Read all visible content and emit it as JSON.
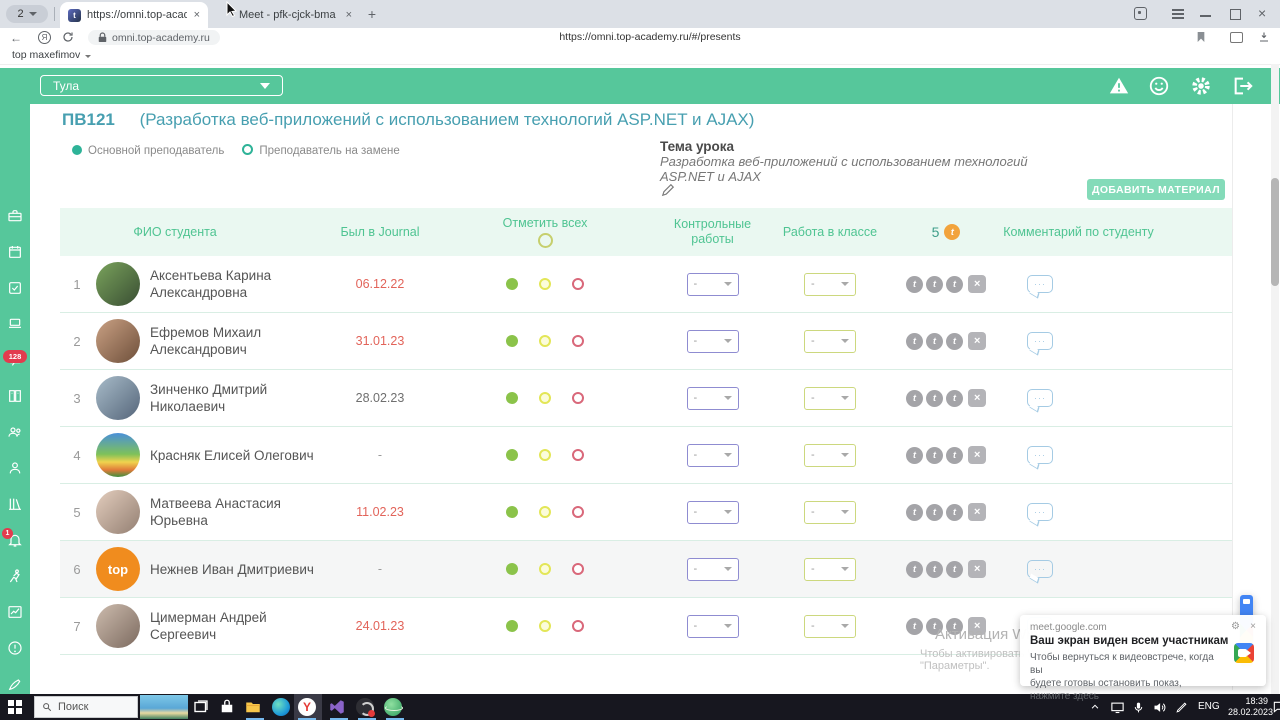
{
  "browser": {
    "tab_count": "2",
    "tab1_title": "https://omni.top-acaden",
    "tab2_title": "Meet - pfk-cjck-bma",
    "url_domain": "omni.top-academy.ru",
    "url_full": "https://omni.top-academy.ru/#/presents",
    "bookmark_label": "top maxefimov"
  },
  "appbar": {
    "city": "Тула"
  },
  "page": {
    "group_code": "ПВ121",
    "group_name": "(Разработка веб-приложений с использованием технологий ASP.NET и AJAX)",
    "legend_main": "Основной преподаватель",
    "legend_substitute": "Преподаватель на замене",
    "topic_label": "Тема урока",
    "topic_line1": "Разработка веб-приложений с использованием технологий",
    "topic_line2": "ASP.NET и AJAX",
    "add_material": "ДОБАВИТЬ МАТЕРИАЛ"
  },
  "table": {
    "col_name": "ФИО студента",
    "col_journal": "Был в Journal",
    "col_mark_all": "Отметить всех",
    "col_tests_1": "Контрольные",
    "col_tests_2": "работы",
    "col_classwork": "Работа в классе",
    "col_coins": "5",
    "col_comment": "Комментарий по студенту",
    "dropdown_value": "-",
    "rows": [
      {
        "num": "1",
        "name": "Аксентьева Карина Александровна",
        "journal": "06.12.22",
        "journal_class": "date red"
      },
      {
        "num": "2",
        "name": "Ефремов Михаил Александрович",
        "journal": "31.01.23",
        "journal_class": "date red"
      },
      {
        "num": "3",
        "name": "Зинченко Дмитрий Николаевич",
        "journal": "28.02.23",
        "journal_class": "date dark"
      },
      {
        "num": "4",
        "name": "Красняк Елисей Олегович",
        "journal": "-",
        "journal_class": "date"
      },
      {
        "num": "5",
        "name": "Матвеева Анастасия Юрьевна",
        "journal": "11.02.23",
        "journal_class": "date red"
      },
      {
        "num": "6",
        "name": "Нежнев Иван Дмитриевич",
        "journal": "-",
        "journal_class": "date",
        "avatar_text": "top"
      },
      {
        "num": "7",
        "name": "Цимерман Андрей Сергеевич",
        "journal": "24.01.23",
        "journal_class": "date red"
      }
    ]
  },
  "sidebar": {
    "messages_badge": "128",
    "notifications_badge": "1"
  },
  "watermark": {
    "line1": "Активация Windows",
    "line2": "Чтобы активировать Windows, перейдите в раздел \"Параметры\"."
  },
  "meet_popup": {
    "source": "meet.google.com",
    "title": "Ваш экран виден всем участникам",
    "body_line1": "Чтобы вернуться к видеовстрече, когда вы",
    "body_line2": "будете готовы остановить показ, нажмите здесь"
  },
  "taskbar": {
    "search": "Поиск",
    "lang": "ENG",
    "time": "18:39",
    "date": "28.02.2023"
  },
  "colors": {
    "brand_green": "#56c79b",
    "title_teal": "#479fb0",
    "late_red": "#e2645a",
    "coin_orange": "#f2a33c"
  }
}
